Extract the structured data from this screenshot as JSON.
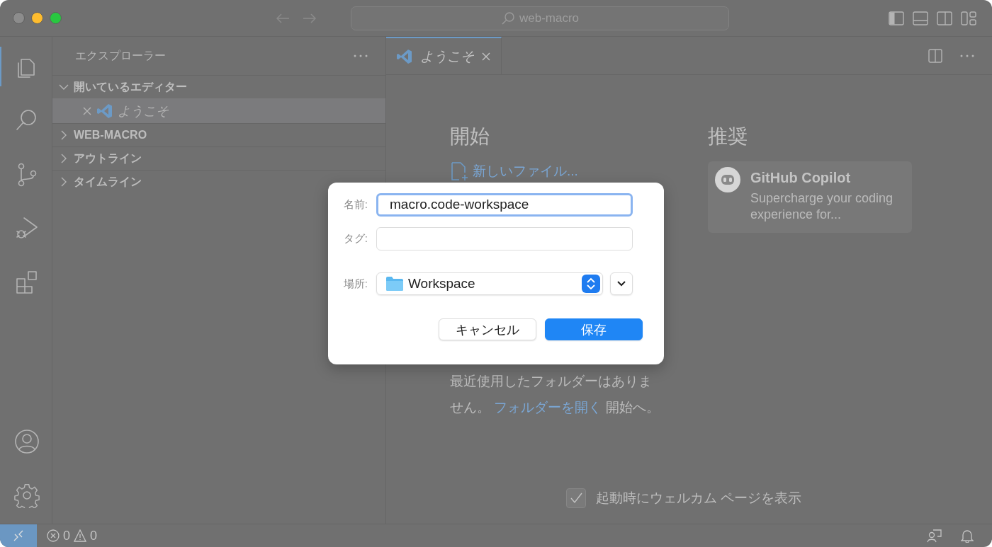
{
  "title_bar": {
    "search": "web-macro"
  },
  "activity_bar": [
    {
      "kind": "files",
      "selected": true
    },
    {
      "kind": "search",
      "selected": false
    },
    {
      "kind": "source-control",
      "selected": false
    },
    {
      "kind": "run",
      "selected": false
    },
    {
      "kind": "extensions",
      "selected": false
    }
  ],
  "activity_bar_bottom": [
    {
      "kind": "account"
    },
    {
      "kind": "settings"
    }
  ],
  "sidebar": {
    "title": "エクスプローラー",
    "sections": [
      {
        "label": "開いているエディター",
        "expanded": true,
        "children": [
          {
            "label": "ようこそ",
            "selected": true
          }
        ]
      },
      {
        "label": "WEB-MACRO",
        "expanded": false
      },
      {
        "label": "アウトライン",
        "expanded": false
      },
      {
        "label": "タイムライン",
        "expanded": false
      }
    ]
  },
  "editor": {
    "tabs": [
      {
        "label": "ようこそ",
        "selected": true
      }
    ]
  },
  "welcome": {
    "start_heading": "開始",
    "start_links": [
      "新しいファイル..."
    ],
    "recent": {
      "before": "最近使用したフォルダーはありません。",
      "link": "フォルダーを開く",
      "after": "開始へ。"
    },
    "recommended_heading": "推奨",
    "recommended": [
      {
        "title": "GitHub Copilot",
        "description": "Supercharge your coding experience for..."
      }
    ],
    "show_on_startup": {
      "label": "起動時にウェルカム ページを表示",
      "checked": true
    }
  },
  "dialog": {
    "name": {
      "label": "名前:",
      "value": "macro.code-workspace",
      "focused": true
    },
    "tag": {
      "label": "タグ:"
    },
    "location": {
      "label": "場所:",
      "value": "Workspace"
    },
    "buttons": [
      {
        "label": "キャンセル",
        "kind": "secondary"
      },
      {
        "label": "保存",
        "kind": "primary"
      }
    ]
  },
  "status_bar": {
    "errors": "0",
    "warnings": "0"
  }
}
